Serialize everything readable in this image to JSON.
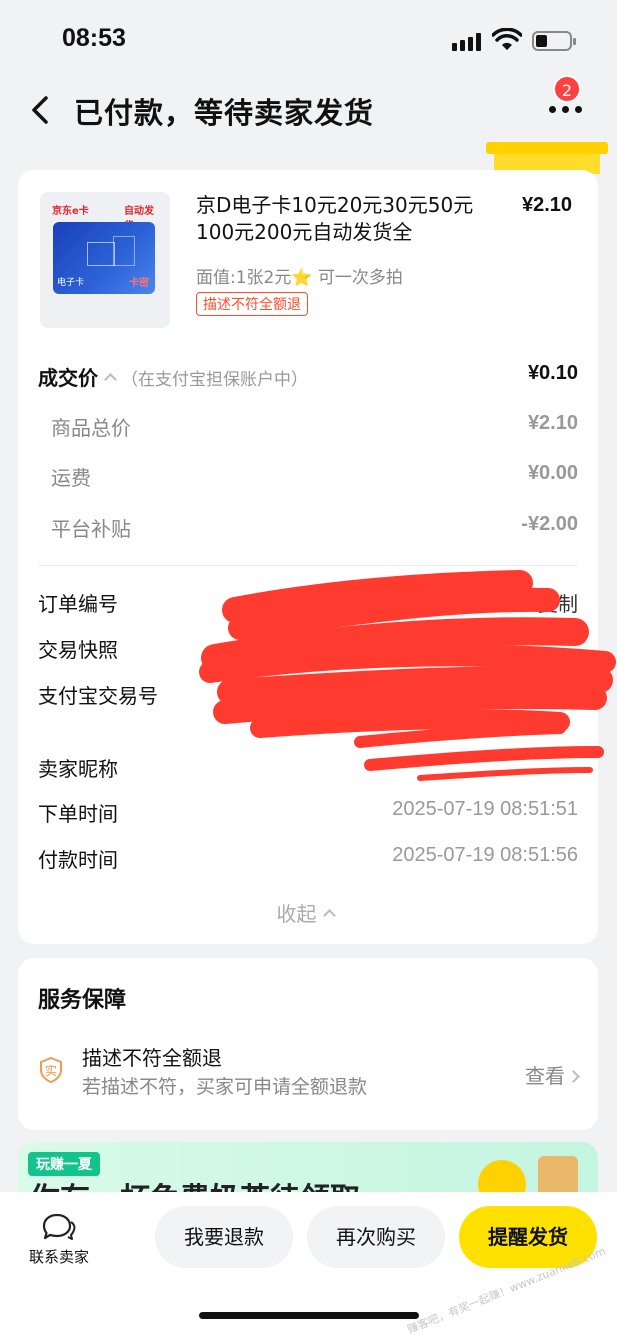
{
  "status_bar": {
    "time": "08:53"
  },
  "nav": {
    "title": "已付款，等待卖家发货",
    "badge_count": "2"
  },
  "product": {
    "image_text_left": "京东e卡",
    "image_text_right": "自动发货",
    "image_bottom_left": "电子卡",
    "image_bottom_right": "卡密",
    "title": "京D电子卡10元20元30元50元100元200元自动发货全",
    "price": "¥2.10",
    "sku": "面值:1张2元⭐ 可一次多拍",
    "tag": "描述不符全额退"
  },
  "price_detail": {
    "deal_label": "成交价",
    "deal_note": "（在支付宝担保账户中）",
    "deal_value": "¥0.10",
    "items": [
      {
        "label": "商品总价",
        "value": "¥2.10"
      },
      {
        "label": "运费",
        "value": "¥0.00"
      },
      {
        "label": "平台补贴",
        "value": "-¥2.00"
      }
    ]
  },
  "order_info": {
    "order_no_label": "订单编号",
    "copy_label": "复制",
    "snapshot_label": "交易快照",
    "alipay_no_label": "支付宝交易号",
    "seller_label": "卖家昵称",
    "order_time_label": "下单时间",
    "order_time_value": "2025-07-19 08:51:51",
    "pay_time_label": "付款时间",
    "pay_time_value": "2025-07-19 08:51:56",
    "collapse_label": "收起"
  },
  "service": {
    "title": "服务保障",
    "item_title": "描述不符全额退",
    "item_desc": "若描述不符，买家可申请全额退款",
    "view_label": "查看"
  },
  "promo": {
    "tag": "玩赚一夏",
    "text": "你有一杯免费奶茶待领取"
  },
  "bottom_bar": {
    "chat_label": "联系卖家",
    "refund_label": "我要退款",
    "rebuy_label": "再次购买",
    "remind_label": "提醒发货",
    "watermark": "赚客吧，有奖一起赚！www.zuanke8.com"
  },
  "colors": {
    "accent_yellow": "#ffe100",
    "badge_red": "#ff4141",
    "tag_red": "#ff4d2d",
    "redaction": "#ff3b30"
  }
}
